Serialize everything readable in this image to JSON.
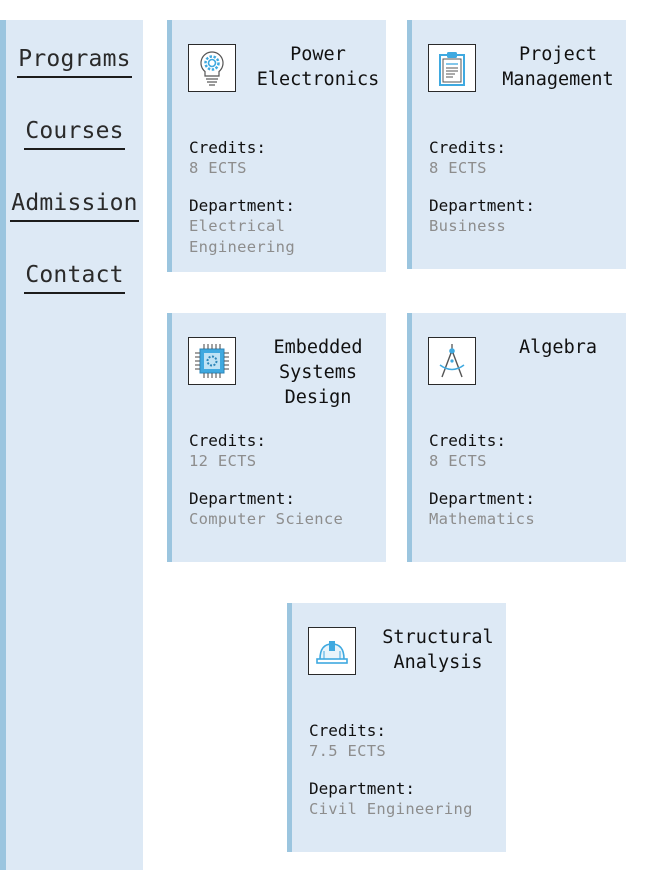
{
  "nav": {
    "items": [
      {
        "label": "Programs"
      },
      {
        "label": "Courses"
      },
      {
        "label": "Admission"
      },
      {
        "label": "Contact"
      }
    ]
  },
  "fields": {
    "credits_label": "Credits:",
    "department_label": "Department:"
  },
  "courses": [
    {
      "title": "Power Electronics",
      "title_lines": [
        "Power",
        "Electronics"
      ],
      "icon": "lightbulb-gear-icon",
      "credits": "8 ECTS",
      "department": "Electrical Engineering",
      "department_lines": [
        "Electrical",
        "Engineering"
      ]
    },
    {
      "title": "Project Management",
      "title_lines": [
        "Project",
        "Management"
      ],
      "icon": "clipboard-icon",
      "credits": "8 ECTS",
      "department": "Business",
      "department_lines": [
        "Business"
      ]
    },
    {
      "title": "Embedded Systems Design",
      "title_lines": [
        "Embedded",
        "Systems",
        "Design"
      ],
      "icon": "microchip-icon",
      "credits": "12 ECTS",
      "department": "Computer Science",
      "department_lines": [
        "Computer Science"
      ]
    },
    {
      "title": "Algebra",
      "title_lines": [
        "Algebra"
      ],
      "icon": "compass-icon",
      "credits": "8 ECTS",
      "department": "Mathematics",
      "department_lines": [
        "Mathematics"
      ]
    },
    {
      "title": "Structural Analysis",
      "title_lines": [
        "Structural",
        "Analysis"
      ],
      "icon": "hard-hat-icon",
      "credits": "7.5 ECTS",
      "department": "Civil Engineering",
      "department_lines": [
        "Civil Engineering"
      ]
    }
  ],
  "colors": {
    "card_bg": "#dde9f5",
    "accent_border": "#9bc5df",
    "icon_blue": "#3fa9e0",
    "value_gray": "#8d8d8d"
  }
}
